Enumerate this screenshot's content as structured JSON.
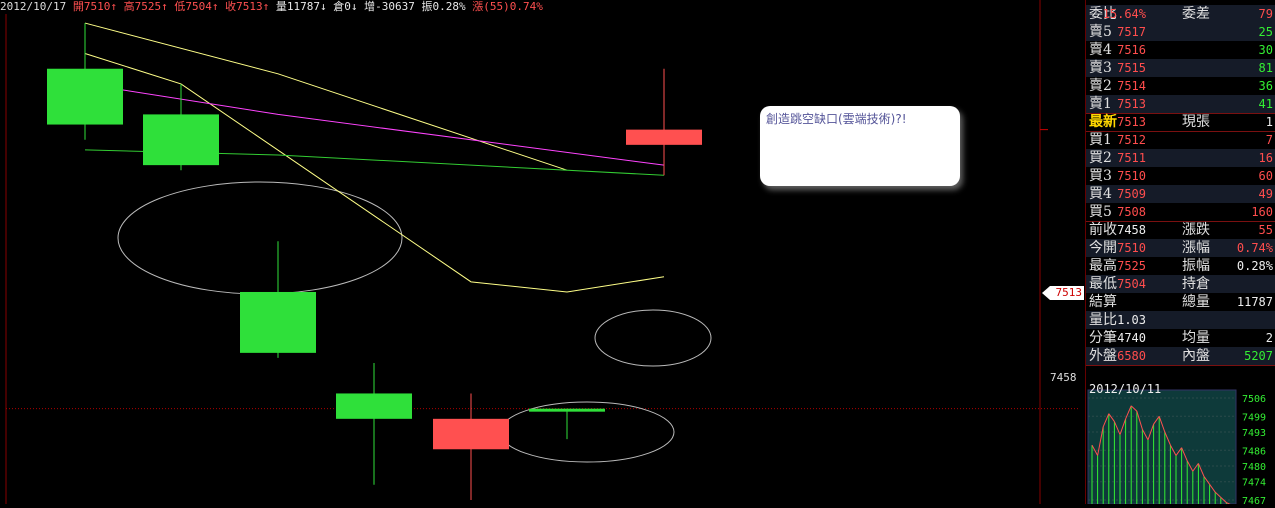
{
  "header": {
    "date": "2012/10/17",
    "items": [
      {
        "text": "開7510↑",
        "color": "red"
      },
      {
        "text": "高7525↑",
        "color": "red"
      },
      {
        "text": "低7504↑",
        "color": "red"
      },
      {
        "text": "收7513↑",
        "color": "red"
      },
      {
        "text": "量11787↓",
        "color": "wht"
      },
      {
        "text": "倉0↓",
        "color": "wht"
      },
      {
        "text": "增-30637",
        "color": "wht"
      },
      {
        "text": "振0.28%",
        "color": "wht"
      },
      {
        "text": "漲(55)0.74%",
        "color": "red"
      }
    ]
  },
  "callout": {
    "text": "創造跳空缺口(雲端技術)?!"
  },
  "axis_tags": {
    "last_price": "7513",
    "prev_close": "7458"
  },
  "chart_data": {
    "type": "candlestick",
    "ylim": [
      7440,
      7535
    ],
    "candles": [
      {
        "open": 7525,
        "high": 7534,
        "low": 7511,
        "close": 7514,
        "color": "green"
      },
      {
        "open": 7516,
        "high": 7522,
        "low": 7505,
        "close": 7506,
        "color": "green"
      },
      {
        "open": 7481,
        "high": 7491,
        "low": 7468,
        "close": 7469,
        "color": "green"
      },
      {
        "open": 7461,
        "high": 7467,
        "low": 7443,
        "close": 7456,
        "color": "green"
      },
      {
        "open": 7450,
        "high": 7461,
        "low": 7440,
        "close": 7456,
        "color": "red"
      },
      {
        "open": 7458,
        "high": 7458,
        "low": 7452,
        "close": 7458,
        "color": "green"
      },
      {
        "open": 7510,
        "high": 7525,
        "low": 7504,
        "close": 7513,
        "color": "red"
      }
    ],
    "moving_averages": [
      {
        "color": "#ffff88",
        "values": [
          7534,
          null,
          7524,
          null,
          null,
          7505,
          null
        ]
      },
      {
        "color": "#ffff88",
        "values": [
          7528,
          7522,
          null,
          null,
          7483,
          7481,
          7484
        ]
      },
      {
        "color": "#ff44ff",
        "values": [
          7522,
          null,
          7516,
          null,
          null,
          null,
          7506
        ]
      },
      {
        "color": "#33cc33",
        "values": [
          7509,
          null,
          7508,
          null,
          null,
          null,
          7504
        ]
      }
    ],
    "previous_close": 7458,
    "annotations": [
      "ellipse",
      "ellipse",
      "ellipse"
    ]
  },
  "quote": {
    "ratio_row": {
      "l1": "委比",
      "v1": "15.64%",
      "l2": "委差",
      "v2": "79"
    },
    "asks": [
      {
        "label": "賣5",
        "price": "7517",
        "vol": "25"
      },
      {
        "label": "賣4",
        "price": "7516",
        "vol": "30"
      },
      {
        "label": "賣3",
        "price": "7515",
        "vol": "81"
      },
      {
        "label": "賣2",
        "price": "7514",
        "vol": "36"
      },
      {
        "label": "賣1",
        "price": "7513",
        "vol": "41"
      }
    ],
    "last": {
      "label": "最新",
      "price": "7513",
      "l2": "現張",
      "vol": "1"
    },
    "bids": [
      {
        "label": "買1",
        "price": "7512",
        "vol": "7"
      },
      {
        "label": "買2",
        "price": "7511",
        "vol": "16"
      },
      {
        "label": "買3",
        "price": "7510",
        "vol": "60"
      },
      {
        "label": "買4",
        "price": "7509",
        "vol": "49"
      },
      {
        "label": "買5",
        "price": "7508",
        "vol": "160"
      }
    ],
    "stats": [
      {
        "l1": "前收",
        "v1": "7458",
        "c1": "wht",
        "l2": "漲跌",
        "v2": "55",
        "c2": "red"
      },
      {
        "l1": "今開",
        "v1": "7510",
        "c1": "red",
        "l2": "漲幅",
        "v2": "0.74%",
        "c2": "red"
      },
      {
        "l1": "最高",
        "v1": "7525",
        "c1": "red",
        "l2": "振幅",
        "v2": "0.28%",
        "c2": "wht"
      },
      {
        "l1": "最低",
        "v1": "7504",
        "c1": "red",
        "l2": "持倉",
        "v2": "",
        "c2": "wht"
      },
      {
        "l1": "結算",
        "v1": "",
        "c1": "wht",
        "l2": "總量",
        "v2": "11787",
        "c2": "wht"
      },
      {
        "l1": "量比",
        "v1": "1.03",
        "c1": "wht",
        "l2": "",
        "v2": "",
        "c2": "wht"
      },
      {
        "l1": "分筆",
        "v1": "4740",
        "c1": "wht",
        "l2": "均量",
        "v2": "2",
        "c2": "wht"
      },
      {
        "l1": "外盤",
        "v1": "6580",
        "c1": "red",
        "l2": "內盤",
        "v2": "5207",
        "c2": "grn"
      }
    ]
  },
  "mini_chart": {
    "date": "2012/10/11",
    "ticks": [
      "7506",
      "7499",
      "7493",
      "7486",
      "7480",
      "7474",
      "7467"
    ],
    "values": [
      7488,
      7484,
      7495,
      7500,
      7497,
      7492,
      7498,
      7503,
      7501,
      7494,
      7490,
      7496,
      7499,
      7493,
      7488,
      7484,
      7487,
      7482,
      7478,
      7481,
      7476,
      7473,
      7470,
      7468,
      7466,
      7465
    ]
  }
}
